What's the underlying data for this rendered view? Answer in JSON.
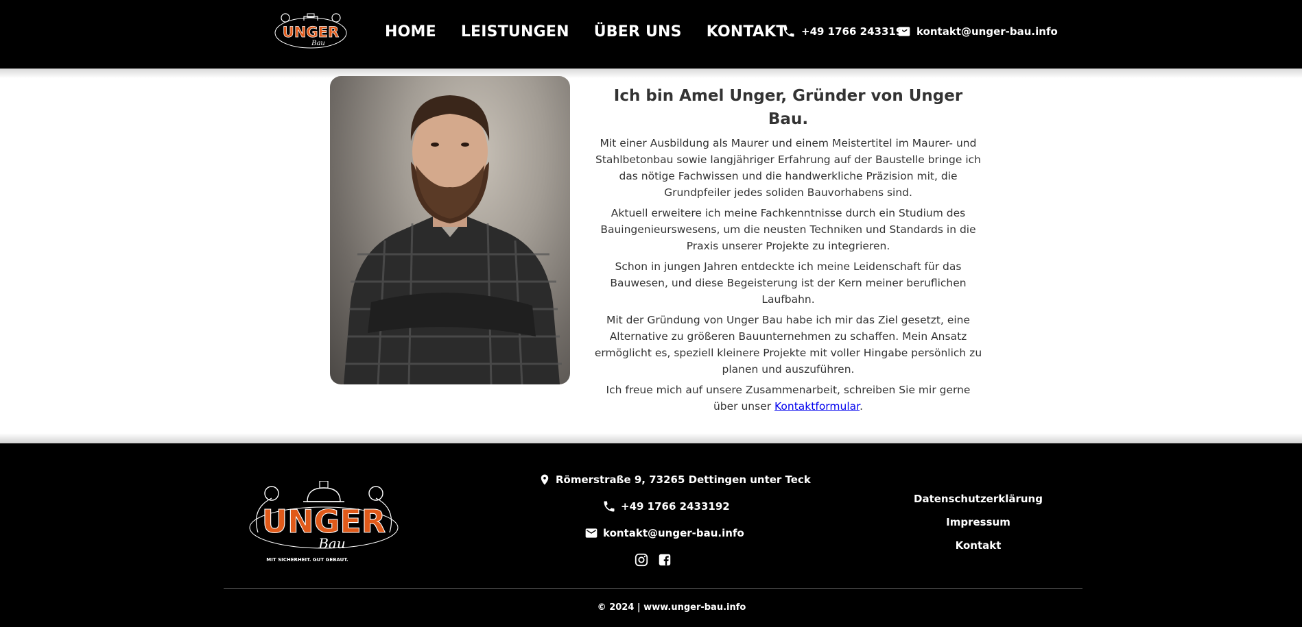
{
  "header": {
    "logo_alt": "Unger Bau",
    "nav": [
      "HOME",
      "LEISTUNGEN",
      "ÜBER UNS",
      "KONTAKT"
    ],
    "phone": "+49 1766 2433192",
    "email": "kontakt@unger-bau.info"
  },
  "intro": {
    "heading": "Ich bin Amel Unger, Gründer von Unger Bau.",
    "paragraphs": [
      "Mit einer Ausbildung als Maurer und einem Meistertitel im Maurer- und Stahlbetonbau sowie langjähriger Erfahrung auf der Baustelle bringe ich das nötige Fachwissen und die handwerkliche Präzision mit, die Grundpfeiler jedes soliden Bauvorhabens sind.",
      "Aktuell erweitere ich meine Fachkenntnisse durch ein Studium des Bauingenieurswesens, um die neusten Techniken und Standards in die Praxis unserer Projekte zu integrieren.",
      "Schon in jungen Jahren entdeckte ich meine Leidenschaft für das Bauwesen, und diese Begeisterung ist der Kern meiner beruflichen Laufbahn.",
      "Mit der Gründung von Unger Bau habe ich mir das Ziel gesetzt, eine Alternative zu größeren Bauunternehmen zu schaffen. Mein Ansatz ermöglicht es, speziell kleinere Projekte mit voller Hingabe persönlich zu planen und auszuführen."
    ],
    "closing_text": "Ich freue mich auf unsere Zusammenarbeit, schreiben Sie mir gerne über unser ",
    "closing_link": "Kontaktformular",
    "closing_end": "."
  },
  "footer": {
    "logo_tagline": "MIT SICHERHEIT. GUT GEBAUT.",
    "address": "Römerstraße 9, 73265 Dettingen unter Teck",
    "phone": "+49 1766 2433192",
    "email": "kontakt@unger-bau.info",
    "links": [
      "Datenschutzerklärung",
      "Impressum",
      "Kontakt"
    ],
    "copyright": "© 2024 | www.unger-bau.info"
  },
  "colors": {
    "brand_orange": "#e05a1a",
    "header_bg": "#000000",
    "link": "#0000ee"
  }
}
